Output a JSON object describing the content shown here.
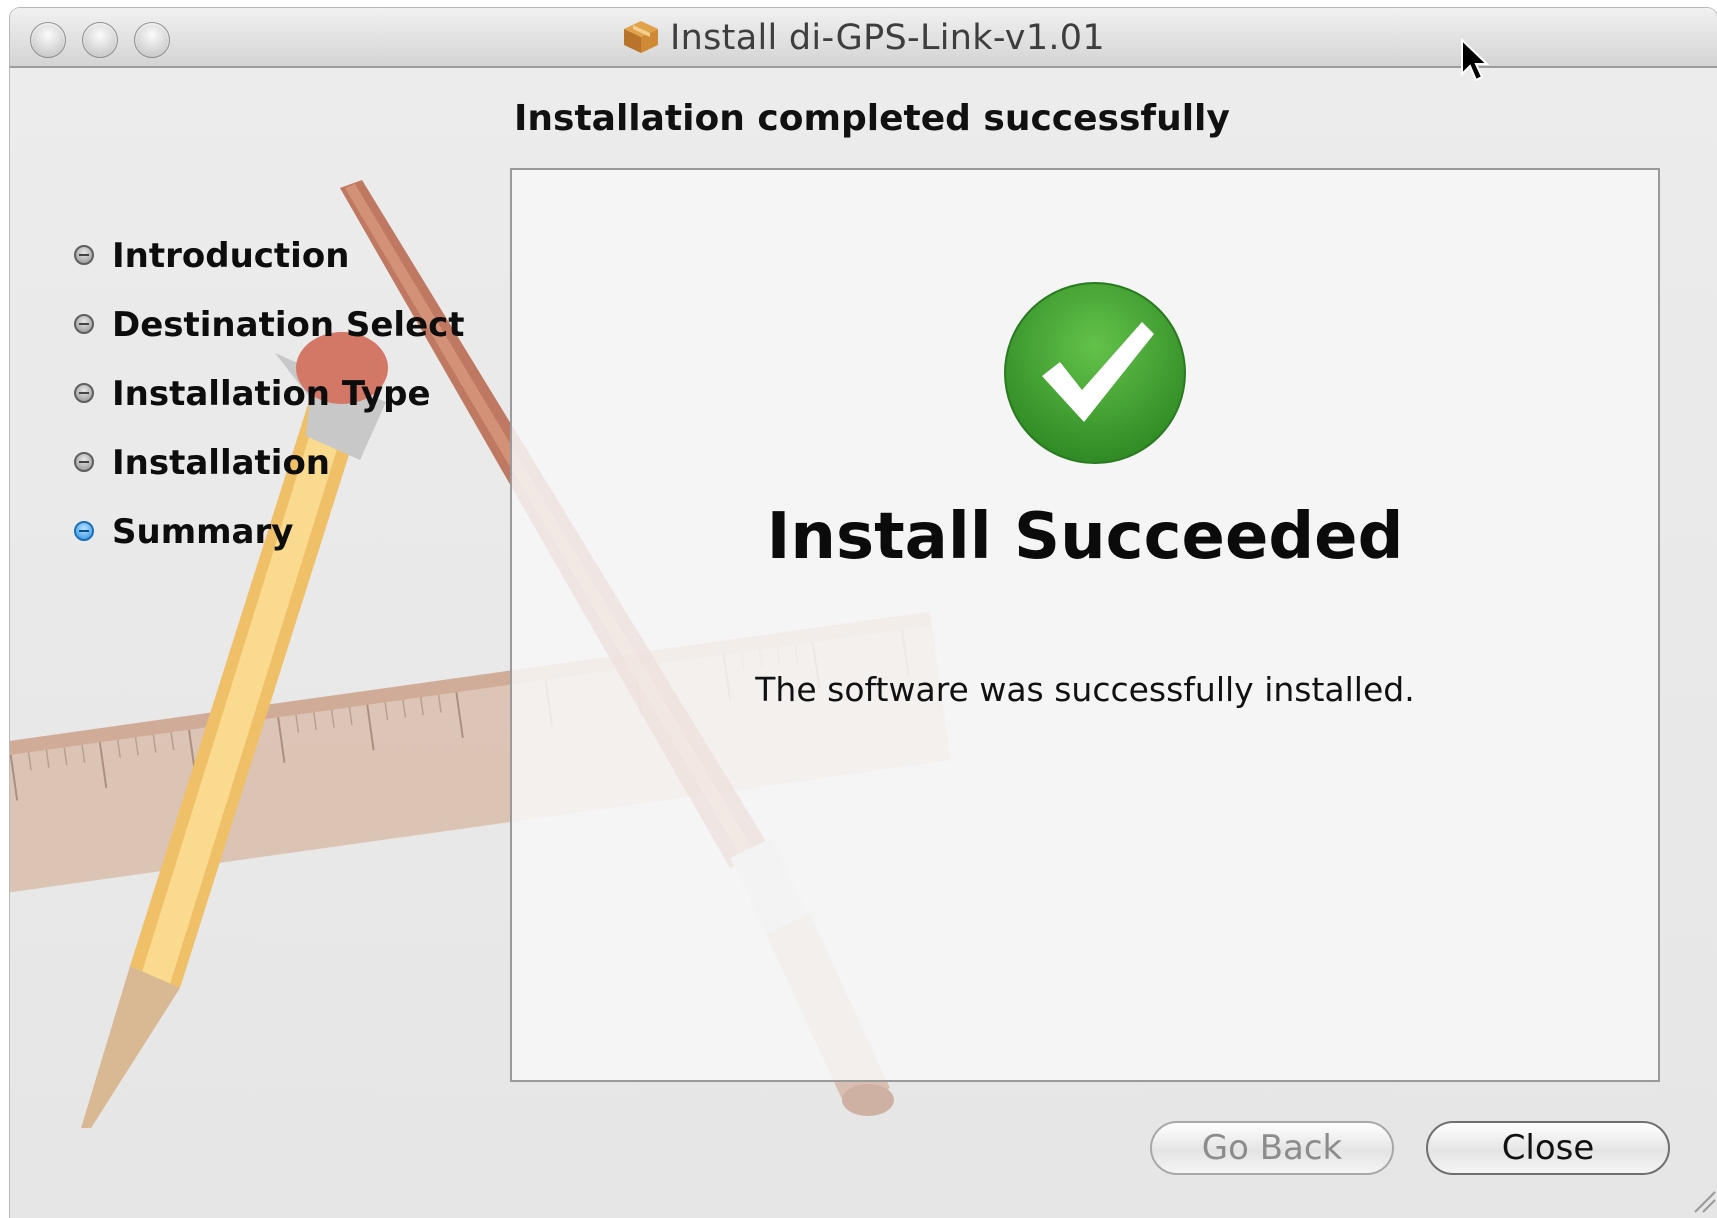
{
  "window": {
    "title": "Install di-GPS-Link-v1.01"
  },
  "header": {
    "heading": "Installation completed successfully"
  },
  "sidebar": {
    "steps": [
      {
        "label": "Introduction",
        "active": false
      },
      {
        "label": "Destination Select",
        "active": false
      },
      {
        "label": "Installation Type",
        "active": false
      },
      {
        "label": "Installation",
        "active": false
      },
      {
        "label": "Summary",
        "active": true
      }
    ]
  },
  "main": {
    "status_title": "Install Succeeded",
    "status_message": "The software was successfully installed."
  },
  "buttons": {
    "go_back": "Go Back",
    "close": "Close"
  },
  "colors": {
    "success_green": "#3fa52f",
    "active_step_blue": "#2b8ee3"
  },
  "icons": {
    "package": "package-icon",
    "success": "checkmark-icon"
  }
}
